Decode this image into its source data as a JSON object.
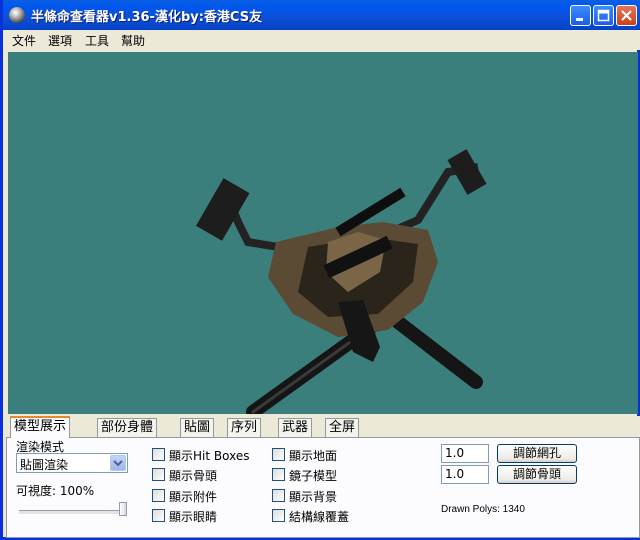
{
  "window": {
    "title": "半條命查看器v1.36-漢化by:香港CS友",
    "icon": "hl-logo-icon",
    "controls": [
      "minimize-icon",
      "maximize-icon",
      "close-icon"
    ]
  },
  "menu": [
    "文件",
    "選項",
    "工具",
    "幫助"
  ],
  "viewport": {
    "background": "#3b7f7c",
    "content": "3D weapon model (submachine gun)"
  },
  "tabs": [
    {
      "label": "模型展示",
      "active": true
    },
    {
      "label": "部份身體",
      "active": false
    },
    {
      "label": "貼圖",
      "active": false
    },
    {
      "label": "序列",
      "active": false
    },
    {
      "label": "武器",
      "active": false
    },
    {
      "label": "全屏",
      "active": false
    }
  ],
  "render": {
    "mode_label": "渲染模式",
    "mode_value": "貼圖渲染",
    "opacity_label": "可視度: 100%",
    "opacity_value": 100
  },
  "checkboxes_col1": [
    {
      "label": "顯示Hit Boxes",
      "checked": false
    },
    {
      "label": "顯示骨頭",
      "checked": false
    },
    {
      "label": "顯示附件",
      "checked": false
    },
    {
      "label": "顯示眼睛",
      "checked": false
    }
  ],
  "checkboxes_col2": [
    {
      "label": "顯示地面",
      "checked": false
    },
    {
      "label": "鏡子模型",
      "checked": false
    },
    {
      "label": "顯示背景",
      "checked": false
    },
    {
      "label": "結構線覆蓋",
      "checked": false
    }
  ],
  "adjust": [
    {
      "value": "1.0",
      "button": "調節網孔"
    },
    {
      "value": "1.0",
      "button": "調節骨頭"
    }
  ],
  "drawn_polys": "Drawn Polys: 1340"
}
